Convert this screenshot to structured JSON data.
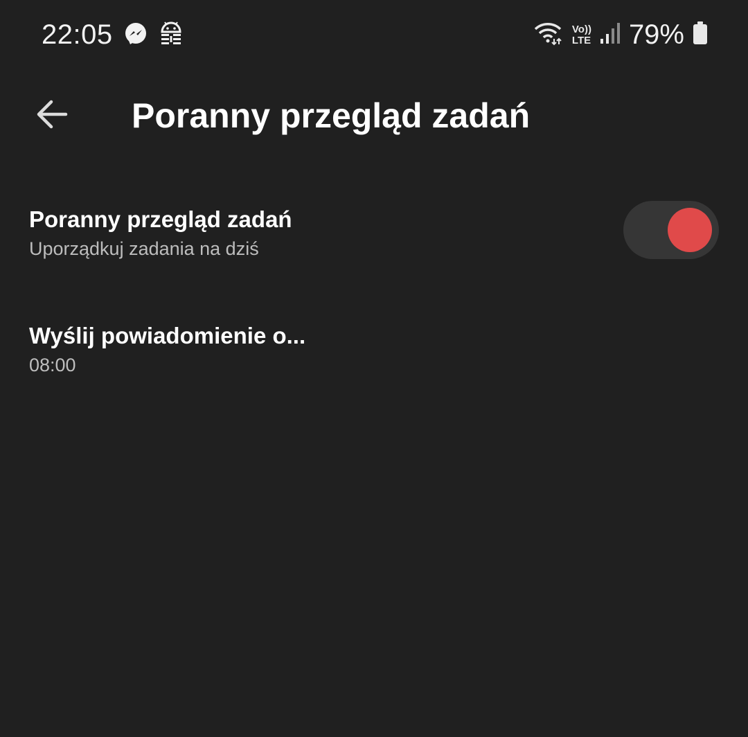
{
  "status_bar": {
    "time": "22:05",
    "left_icons": [
      "messenger-icon",
      "android-debug-icon"
    ],
    "right_icons": [
      "wifi-icon",
      "volte-icon",
      "signal-icon",
      "battery-icon"
    ],
    "volte_top": "Vo))",
    "volte_bottom": "LTE",
    "battery_percent": "79%"
  },
  "header": {
    "back_icon": "arrow-left-icon",
    "title": "Poranny przegląd zadań"
  },
  "settings": [
    {
      "title": "Poranny przegląd zadań",
      "subtitle": "Uporządkuj zadania na dziś",
      "toggle_on": true
    },
    {
      "title": "Wyślij powiadomienie o...",
      "subtitle": "08:00"
    }
  ],
  "colors": {
    "background": "#202020",
    "accent": "#e04a4a",
    "toggle_track": "#363636",
    "secondary_text": "#bdbdbd"
  }
}
